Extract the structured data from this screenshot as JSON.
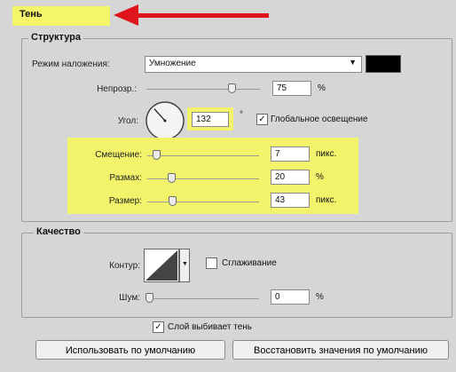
{
  "tab_title": "Тень",
  "structure": {
    "legend": "Структура",
    "blend_mode": {
      "label": "Режим наложения:",
      "value": "Умножение",
      "color": "#000000"
    },
    "opacity": {
      "label": "Непрозр.:",
      "value": "75",
      "unit": "%",
      "fraction": 0.75
    },
    "angle": {
      "label": "Угол:",
      "value": "132",
      "unit": "°",
      "degrees": 132
    },
    "global_light": {
      "label": "Глобальное освещение",
      "checked": true
    },
    "distance": {
      "label": "Смещение:",
      "value": "7",
      "unit": "пикс."
    },
    "spread": {
      "label": "Размах:",
      "value": "20",
      "unit": "%"
    },
    "size": {
      "label": "Размер:",
      "value": "43",
      "unit": "пикс."
    }
  },
  "quality": {
    "legend": "Качество",
    "contour": {
      "label": "Контур:"
    },
    "anti_aliased": {
      "label": "Сглаживание",
      "checked": false
    },
    "noise": {
      "label": "Шум:",
      "value": "0",
      "unit": "%"
    }
  },
  "layer_knocks_out": {
    "label": "Слой выбивает тень",
    "checked": true
  },
  "buttons": {
    "make_default": "Использовать по умолчанию",
    "reset_default": "Восстановить значения по умолчанию"
  },
  "colors": {
    "highlight": "#f2f26b",
    "arrow": "#e0141b"
  }
}
